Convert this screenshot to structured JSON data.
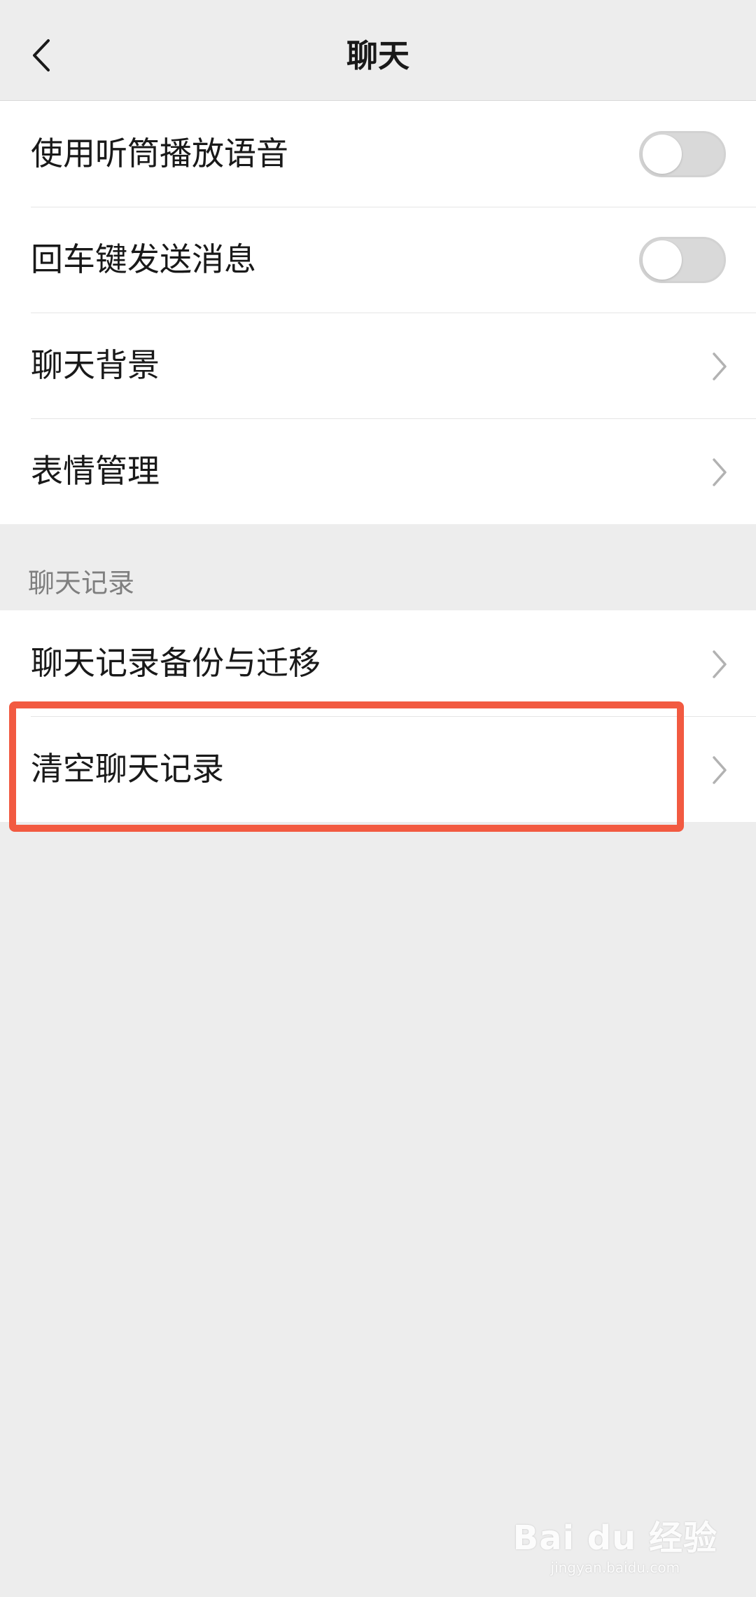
{
  "header": {
    "title": "聊天"
  },
  "settings_group": [
    {
      "label": "使用听筒播放语音",
      "control": "switch",
      "on": false
    },
    {
      "label": "回车键发送消息",
      "control": "switch",
      "on": false
    },
    {
      "label": "聊天背景",
      "control": "chevron"
    },
    {
      "label": "表情管理",
      "control": "chevron"
    }
  ],
  "history_section": {
    "header": "聊天记录",
    "items": [
      {
        "label": "聊天记录备份与迁移",
        "control": "chevron"
      },
      {
        "label": "清空聊天记录",
        "control": "chevron"
      }
    ]
  },
  "annotation": {
    "color": "#f25a41",
    "target": "清空聊天记录"
  },
  "watermark": {
    "logo": "Bai du 经验",
    "url": "jingyan.baidu.com"
  },
  "colors": {
    "background": "#ededed",
    "card": "#ffffff",
    "text": "#191919",
    "section_header": "#7f7f7f",
    "switch_off": "#d9d9d9"
  }
}
